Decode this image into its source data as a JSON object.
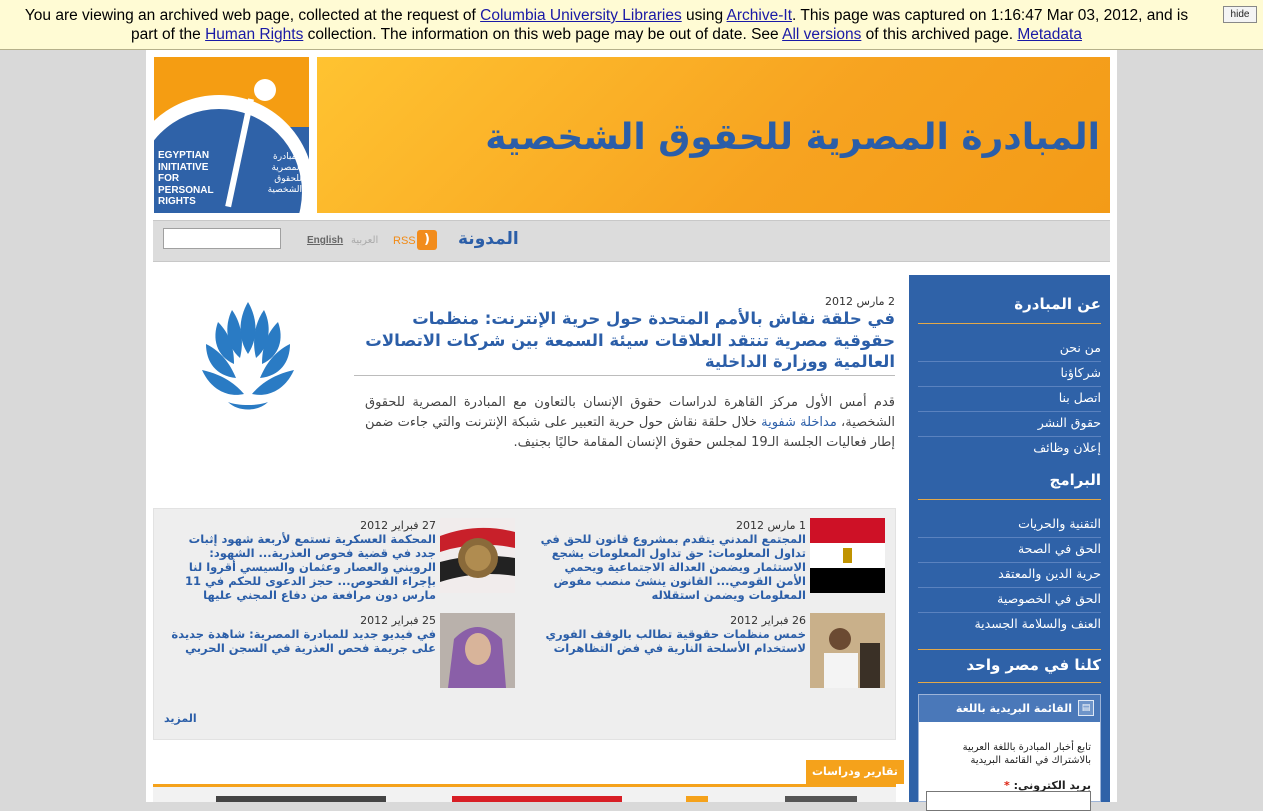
{
  "archive": {
    "t1": "You are viewing an archived web page, collected at the request of ",
    "l1": "Columbia University Libraries",
    "t2": " using ",
    "l2": "Archive-It",
    "t3": ". This page was captured on 1:16:47 Mar 03, 2012, and is part of the ",
    "l3": "Human Rights",
    "t4": " collection. The information on this web page may be out of date. See ",
    "l4": "All versions",
    "t5": " of this archived page. ",
    "l5": "Metadata",
    "hide": "hide"
  },
  "header": {
    "title": "المبادرة المصرية للحقوق الشخصية",
    "logo_en": "EGYPTIAN INITIATIVE FOR PERSONAL RIGHTS",
    "logo_ar": "المبادرة المصرية للحقوق الشخصية"
  },
  "nav": {
    "blog": "المدونة",
    "rss": "RSS",
    "lang_ar": "العربية",
    "lang_en": "English",
    "search_value": ""
  },
  "featured": {
    "date": "2 مارس 2012",
    "title": "في حلقة نقاش بالأمم المتحدة حول حرية الإنترنت: منظمات حقوقية مصرية تنتقد العلاقات سيئة السمعة بين شركات الاتصالات العالمية ووزارة الداخلية",
    "body_1": "قدم أمس الأول مركز القاهرة لدراسات حقوق الإنسان بالتعاون مع المبادرة المصرية للحقوق الشخصية، ",
    "body_link": "مداخلة شفوية",
    "body_2": " خلال حلقة نقاش حول حرية التعبير على شبكة الإنترنت والتي جاءت ضمن إطار فعاليات الجلسة الـ19 لمجلس حقوق الإنسان المقامة حاليًا بجنيف."
  },
  "news": [
    {
      "date": "1 مارس 2012",
      "title": "المجتمع المدني يتقدم بمشروع قانون للحق في تداول المعلومات: حق تداول المعلومات يشجع الاستثمار ويضمن العدالة الاجتماعية ويحمي الأمن القومي... القانون ينشئ منصب مفوض المعلومات ويضمن استقلاله"
    },
    {
      "date": "27 فبراير 2012",
      "title": "المحكمة العسكرية تستمع لأربعة شهود إثبات جدد في قضية فحوص العذرية... الشهود: الرويني والعصار وعثمان والسيسي أقروا لنا بإجراء الفحوص... حجز الدعوى للحكم في 11 مارس دون مرافعة من دفاع المجني عليها"
    },
    {
      "date": "26 فبراير 2012",
      "title": "خمس منظمات حقوقية تطالب بالوقف الفوري لاستخدام الأسلحة النارية في فض التظاهرات"
    },
    {
      "date": "25 فبراير 2012",
      "title": "في فيديو جديد للمبادرة المصرية: شاهدة جديدة على جريمة فحص العذرية في السجن الحربي"
    }
  ],
  "more": "المزيد",
  "reports_tab": "تقارير ودراسات",
  "sidebar": {
    "about_heading": "عن المبادرة",
    "about_items": [
      "من نحن",
      "شركاؤنا",
      "اتصل بنا",
      "حقوق النشر",
      "إعلان وظائف"
    ],
    "programs_heading": "البرامج",
    "program_items": [
      "التقنية والحريات",
      "الحق في الصحة",
      "حرية الدين والمعتقد",
      "الحق في الخصوصية",
      "العنف والسلامة الجسدية"
    ],
    "slogan": "كلنا في مصر واحد",
    "newsletter_title": "القائمة البريدية باللغة العربية",
    "newsletter_text": "تابع أخبار المبادرة باللغة العربية بالاشتراك في القائمة البريدية",
    "email_label": "بريد الكتروني:",
    "required_mark": "*"
  },
  "colors": {
    "brand_blue": "#2f62a8",
    "brand_orange": "#f5a21b",
    "banner_yellow": "#fffbd4"
  }
}
